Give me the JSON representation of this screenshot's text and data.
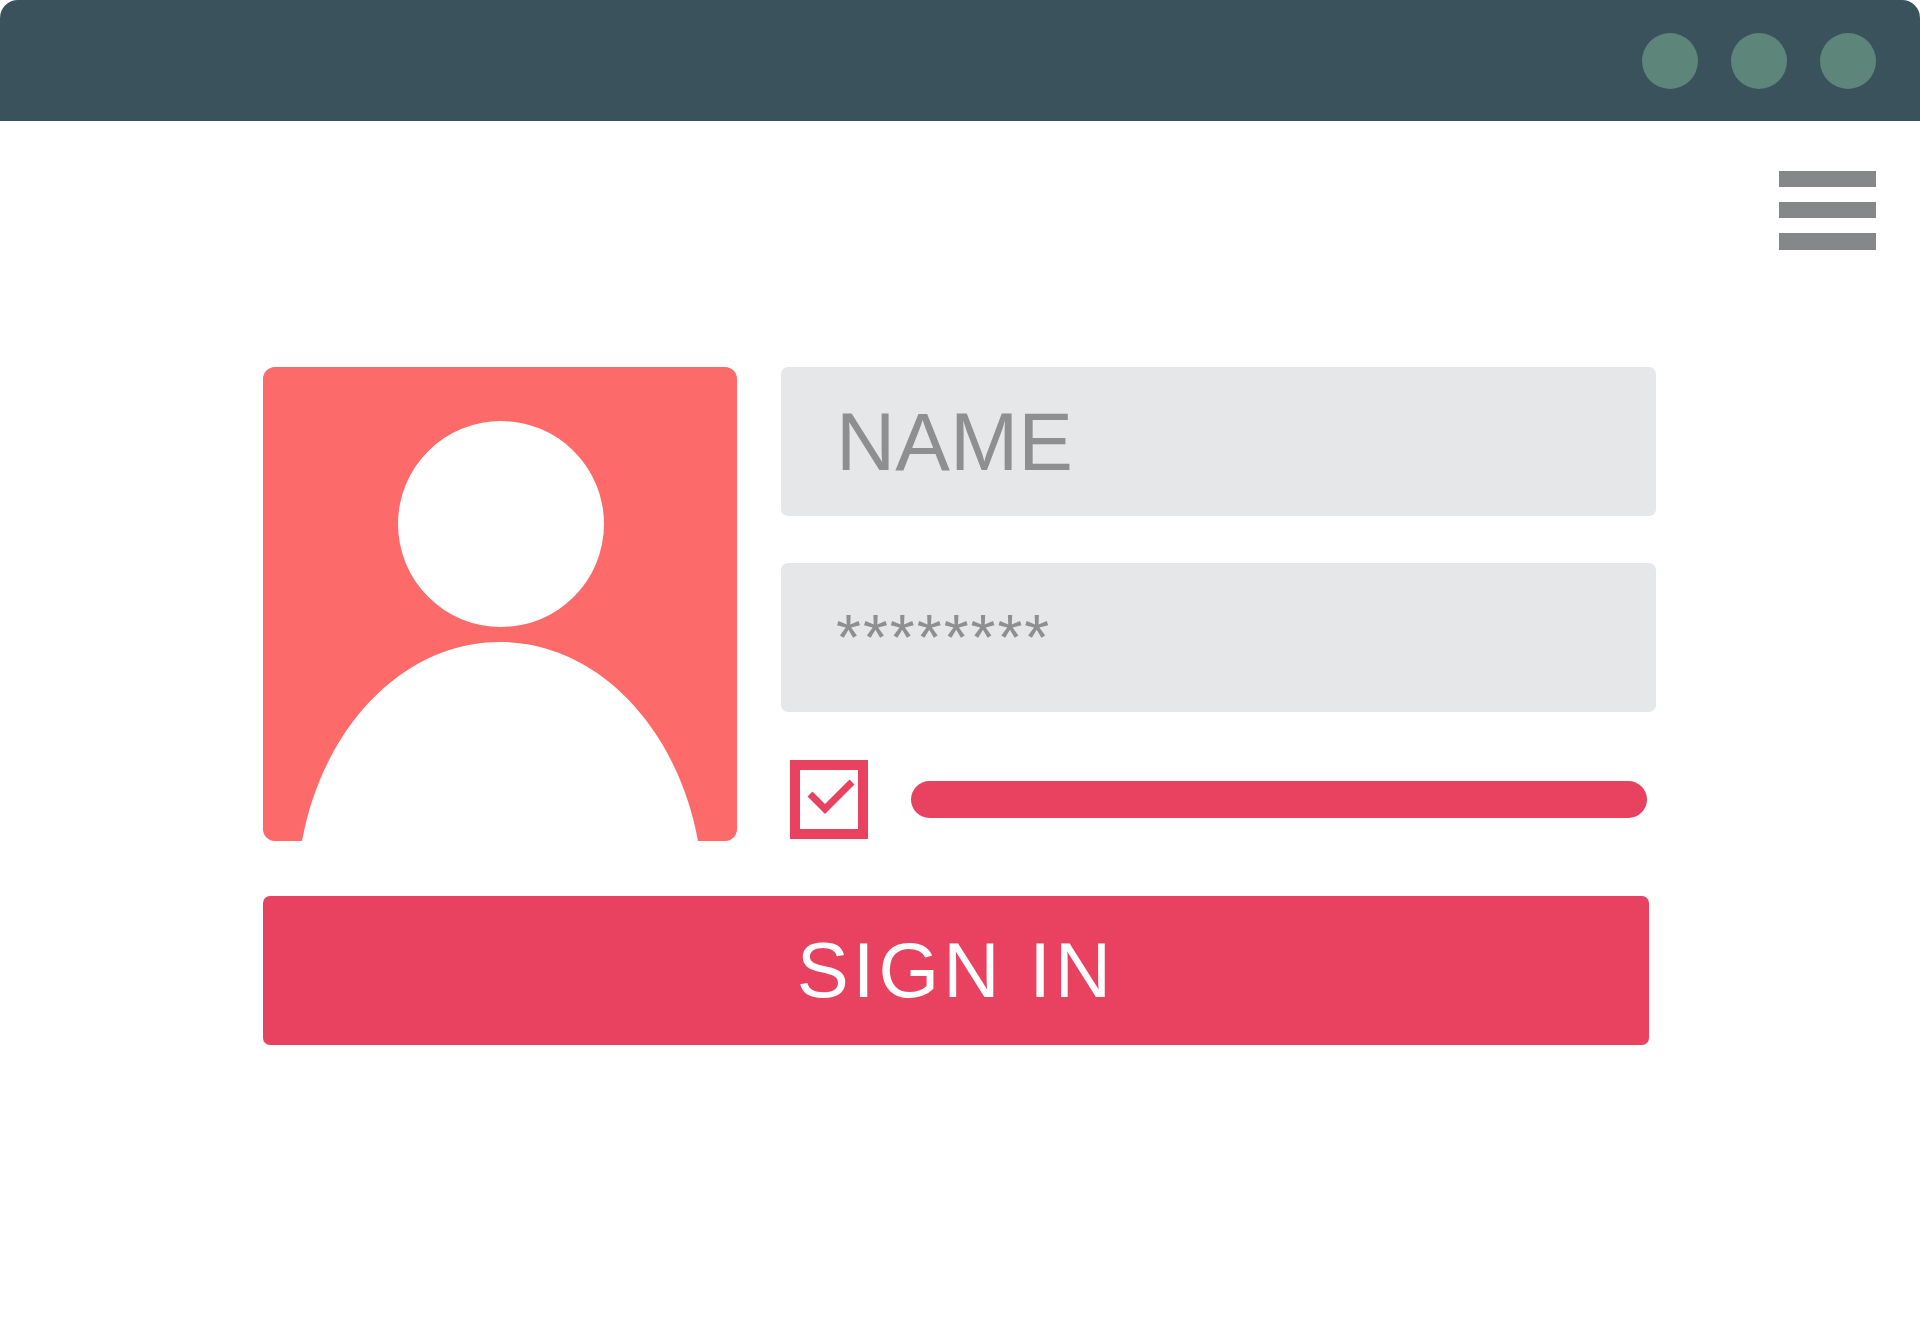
{
  "name_field": {
    "placeholder": "NAME"
  },
  "password_field": {
    "value": "********"
  },
  "remember": {
    "checked": true
  },
  "sign_in_button": {
    "label": "SIGN IN"
  }
}
